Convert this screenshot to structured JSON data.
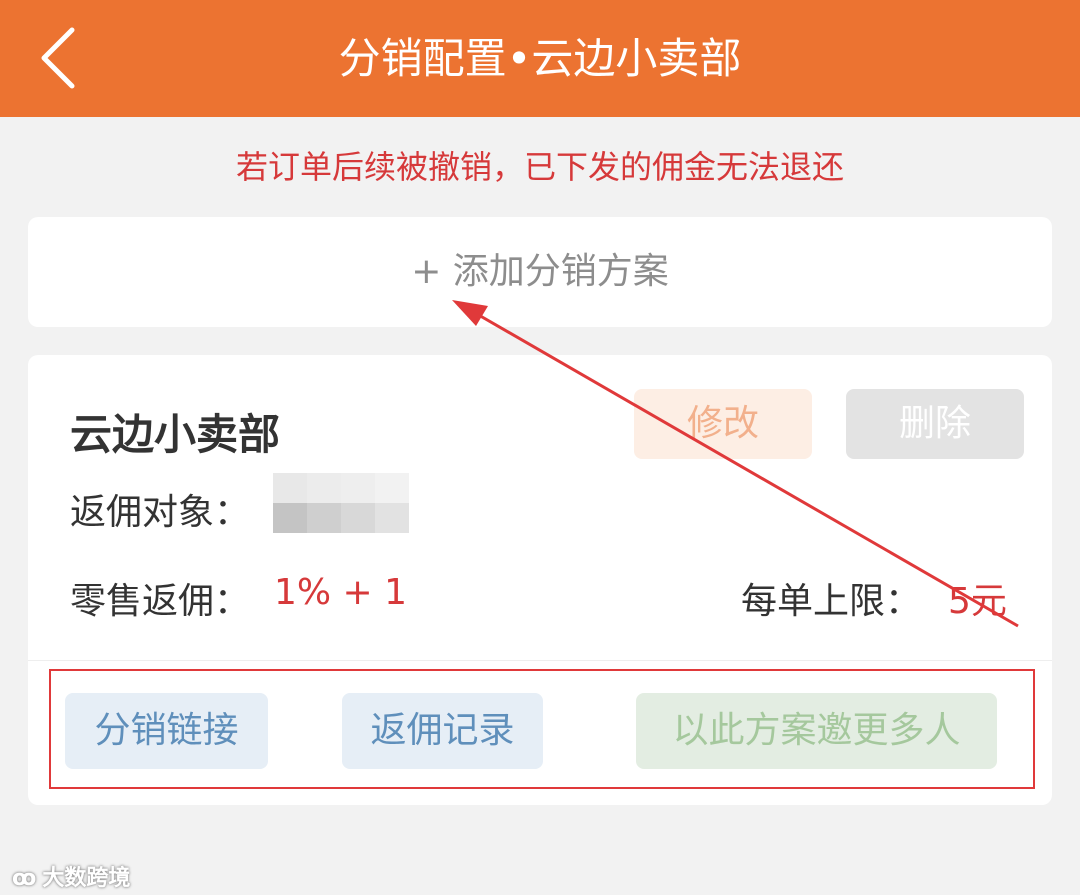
{
  "header": {
    "title": "分销配置•云边小卖部"
  },
  "notice": "若订单后续被撤销，已下发的佣金无法退还",
  "add_plan": {
    "label": "+ 添加分销方案"
  },
  "plan": {
    "name": "云边小卖部",
    "edit_label": "修改",
    "delete_label": "删除",
    "target_label": "返佣对象：",
    "retail_label": "零售返佣：",
    "retail_value": "1% + 1",
    "limit_label": "每单上限：",
    "limit_value": "5元",
    "actions": [
      {
        "label": "分销链接"
      },
      {
        "label": "返佣记录"
      },
      {
        "label": "以此方案邀更多人"
      }
    ]
  },
  "watermark": {
    "logo": "ꝏ",
    "text": "大数跨境"
  },
  "colors": {
    "header": "#ec7331",
    "warning": "#d6393a",
    "annotation": "#e0393a"
  }
}
